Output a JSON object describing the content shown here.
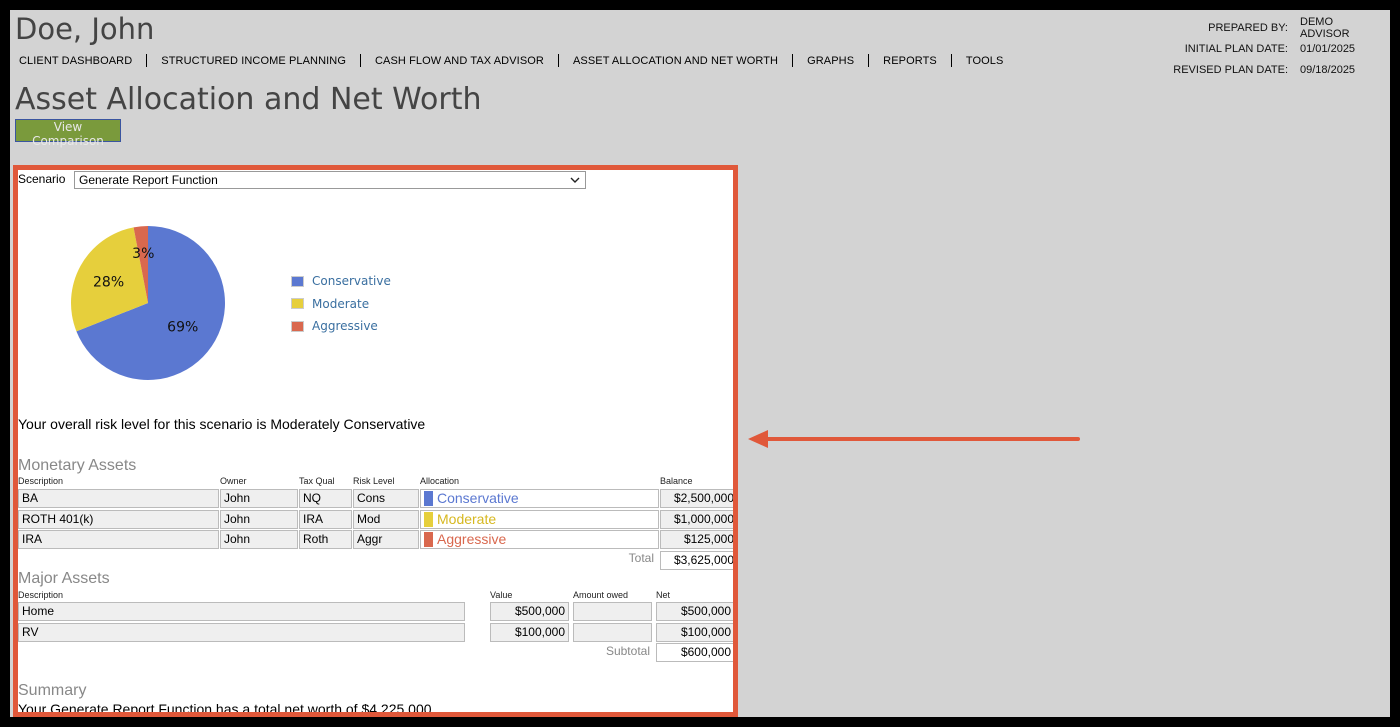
{
  "client": {
    "name": "Doe, John"
  },
  "plan_info": [
    {
      "label": "PREPARED BY:",
      "value": "DEMO ADVISOR"
    },
    {
      "label": "INITIAL PLAN DATE:",
      "value": "01/01/2025"
    },
    {
      "label": "REVISED PLAN DATE:",
      "value": "09/18/2025"
    }
  ],
  "nav": [
    "CLIENT DASHBOARD",
    "STRUCTURED INCOME PLANNING",
    "CASH FLOW AND TAX ADVISOR",
    "ASSET ALLOCATION AND NET WORTH",
    "GRAPHS",
    "REPORTS",
    "TOOLS"
  ],
  "page": {
    "title": "Asset Allocation and Net Worth",
    "compare_button": "View Comparison"
  },
  "scenario": {
    "label": "Scenario",
    "selected": "Generate Report Function"
  },
  "chart_data": {
    "type": "pie",
    "categories": [
      "Conservative",
      "Moderate",
      "Aggressive"
    ],
    "values": [
      69,
      28,
      3
    ],
    "labels": [
      "69%",
      "28%",
      "3%"
    ],
    "colors": [
      "#5b78d1",
      "#e6cf3c",
      "#d9684e"
    ],
    "legend": "right"
  },
  "risk_text": "Your overall risk level for this scenario is Moderately Conservative",
  "monetary": {
    "title": "Monetary Assets",
    "headers": {
      "description": "Description",
      "owner": "Owner",
      "tax_qual": "Tax Qual",
      "risk": "Risk Level",
      "allocation": "Allocation",
      "balance": "Balance"
    },
    "rows": [
      {
        "description": "BA",
        "owner": "John",
        "tax_qual": "NQ",
        "risk": "Cons",
        "allocation": "Conservative",
        "color": "#5b78d1",
        "balance": "$2,500,000"
      },
      {
        "description": "ROTH 401(k)",
        "owner": "John",
        "tax_qual": "IRA",
        "risk": "Mod",
        "allocation": "Moderate",
        "color": "#e6cf3c",
        "balance": "$1,000,000"
      },
      {
        "description": "IRA",
        "owner": "John",
        "tax_qual": "Roth",
        "risk": "Aggr",
        "allocation": "Aggressive",
        "color": "#d9684e",
        "balance": "$125,000"
      }
    ],
    "total_label": "Total",
    "total": "$3,625,000"
  },
  "major": {
    "title": "Major Assets",
    "headers": {
      "description": "Description",
      "value": "Value",
      "owed": "Amount owed",
      "net": "Net"
    },
    "rows": [
      {
        "description": "Home",
        "value": "$500,000",
        "owed": "",
        "net": "$500,000"
      },
      {
        "description": "RV",
        "value": "$100,000",
        "owed": "",
        "net": "$100,000"
      }
    ],
    "subtotal_label": "Subtotal",
    "subtotal": "$600,000"
  },
  "summary": {
    "title": "Summary",
    "text": "Your Generate Report Function has a total net worth of $4,225,000"
  }
}
